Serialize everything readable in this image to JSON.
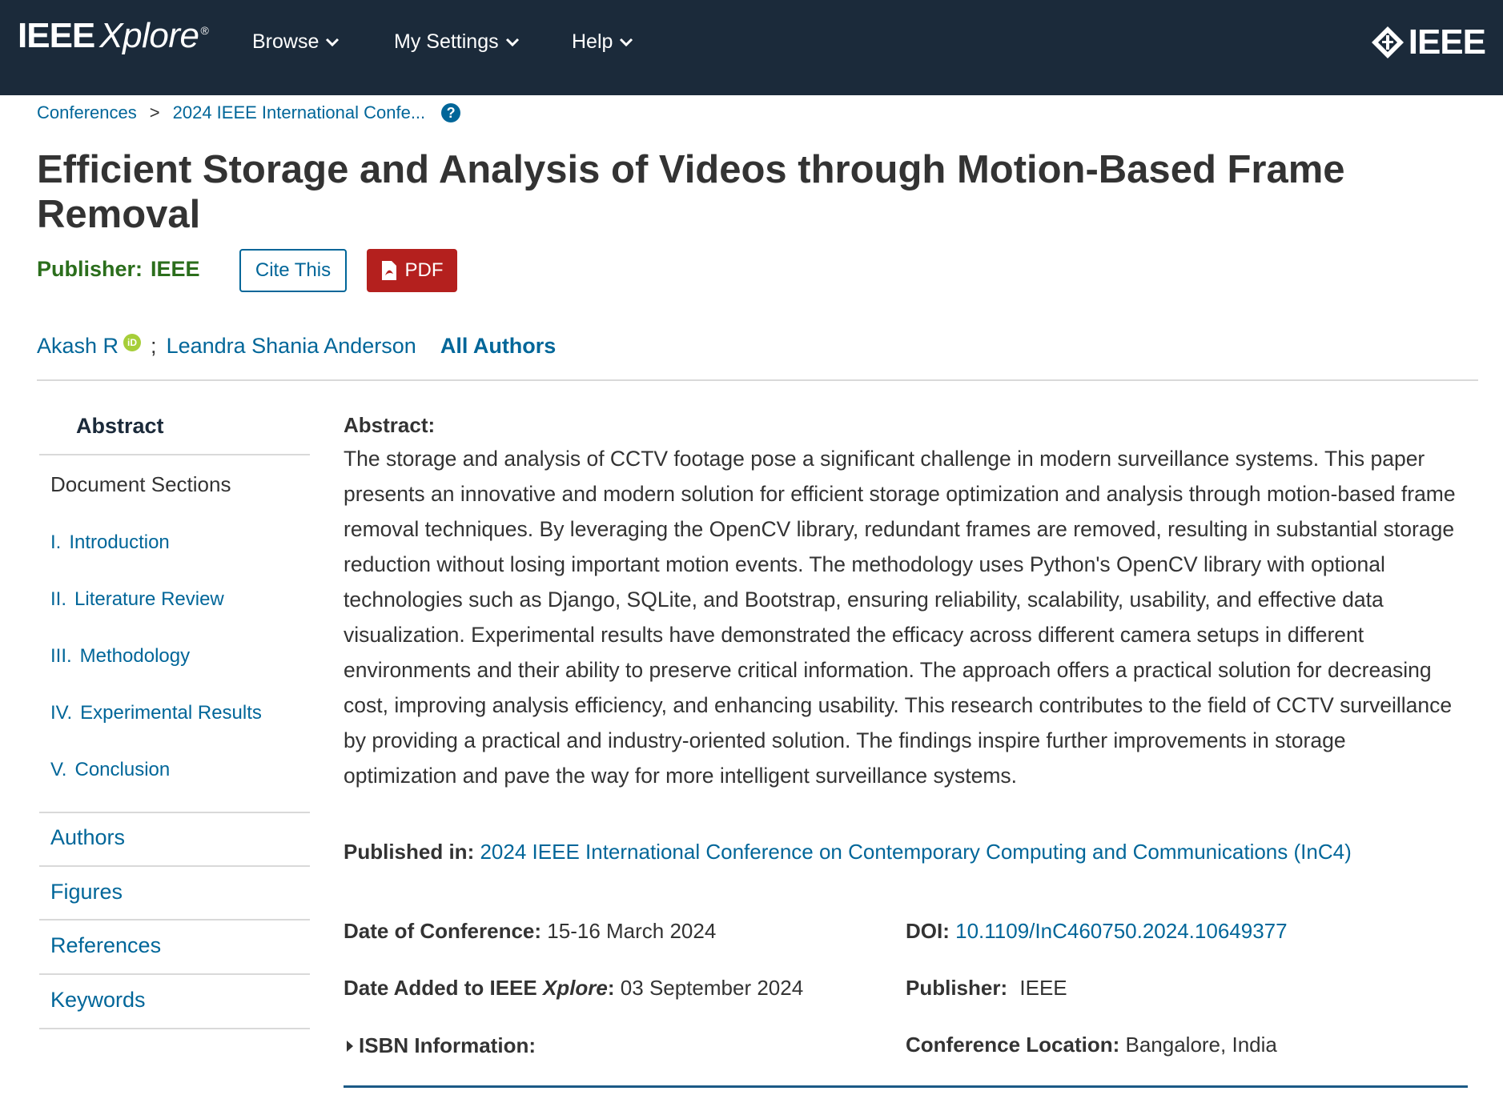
{
  "header": {
    "logo_main": "IEEE",
    "logo_sub": "Xplore",
    "logo_mark": "®",
    "nav": [
      {
        "label": "Browse"
      },
      {
        "label": "My Settings"
      },
      {
        "label": "Help"
      }
    ],
    "brand": "IEEE"
  },
  "breadcrumb": {
    "items": [
      "Conferences",
      "2024 IEEE International Confe..."
    ],
    "separator": ">",
    "help": "?"
  },
  "article": {
    "title": "Efficient Storage and Analysis of Videos through Motion-Based Frame Removal",
    "publisher_label": "Publisher:",
    "publisher_value": "IEEE",
    "cite_label": "Cite This",
    "pdf_label": "PDF",
    "authors": [
      "Akash R",
      "Leandra Shania Anderson"
    ],
    "author_separator": ";",
    "orcid_badge": "iD",
    "all_authors_label": "All Authors"
  },
  "sidebar": {
    "abstract_label": "Abstract",
    "document_sections_label": "Document Sections",
    "sections": [
      {
        "num": "I.",
        "label": "Introduction"
      },
      {
        "num": "II.",
        "label": "Literature Review"
      },
      {
        "num": "III.",
        "label": "Methodology"
      },
      {
        "num": "IV.",
        "label": "Experimental Results"
      },
      {
        "num": "V.",
        "label": "Conclusion"
      }
    ],
    "links": [
      "Authors",
      "Figures",
      "References",
      "Keywords"
    ]
  },
  "abstract": {
    "label": "Abstract:",
    "text": "The storage and analysis of CCTV footage pose a significant challenge in modern surveillance systems. This paper presents an innovative and modern solution for efficient storage optimization and analysis through motion-based frame removal techniques. By leveraging the OpenCV library, redundant frames are removed, resulting in substantial storage reduction without losing important motion events. The methodology uses Python's OpenCV library with optional technologies such as Django, SQLite, and Bootstrap, ensuring reliability, scalability, usability, and effective data visualization. Experimental results have demonstrated the efficacy across different camera setups in different environments and their ability to preserve critical information. The approach offers a practical solution for decreasing cost, improving analysis efficiency, and enhancing usability. This research contributes to the field of CCTV surveillance by providing a practical and industry-oriented solution. The findings inspire further improvements in storage optimization and pave the way for more intelligent surveillance systems."
  },
  "details": {
    "published_in_label": "Published in:",
    "published_in_value": "2024 IEEE International Conference on Contemporary Computing and Communications (InC4)",
    "date_conf_label": "Date of Conference:",
    "date_conf_value": "15-16 March 2024",
    "date_added_label_pre": "Date Added to IEEE ",
    "date_added_label_em": "Xplore",
    "date_added_label_post": ":",
    "date_added_value": "03 September 2024",
    "isbn_label": "ISBN Information:",
    "doi_label": "DOI:",
    "doi_value": "10.1109/InC460750.2024.10649377",
    "publisher_label": "Publisher:",
    "publisher_value": "IEEE",
    "location_label": "Conference Location:",
    "location_value": "Bangalore, India"
  },
  "colors": {
    "topbar": "#1b2a3a",
    "link": "#006699",
    "publisher_green": "#2b6e1c",
    "pdf_red": "#b4201e",
    "orcid_green": "#a6ce39"
  }
}
